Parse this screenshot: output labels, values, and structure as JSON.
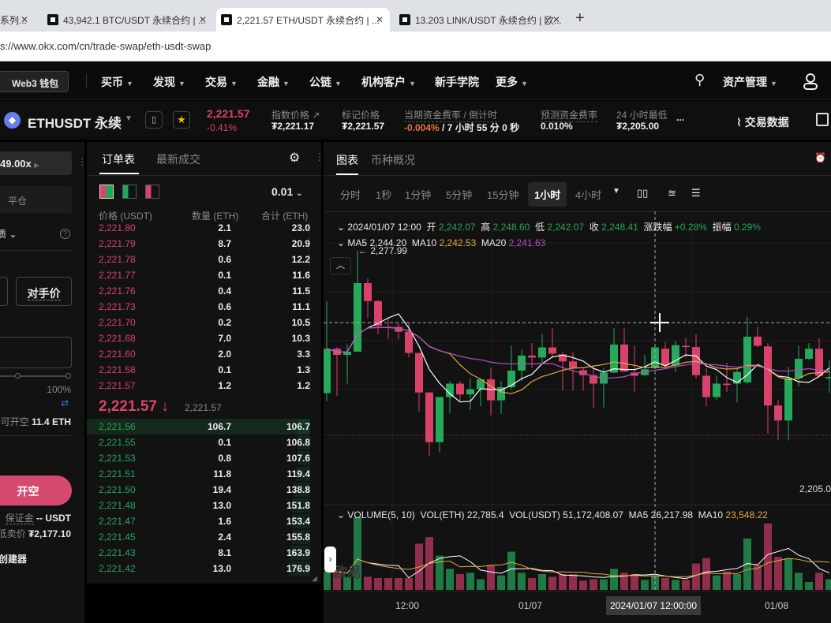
{
  "browser": {
    "tabs": [
      {
        "title": "系列..."
      },
      {
        "title": "43,942.1 BTC/USDT 永续合约 | ..."
      },
      {
        "title": "2,221.57 ETH/USDT 永续合约 | ...",
        "active": true
      },
      {
        "title": "13.203 LINK/USDT 永续合约 | 欧..."
      }
    ],
    "new_tab": "+",
    "url": "s://www.okx.com/cn/trade-swap/eth-usdt-swap"
  },
  "nav": {
    "wallet": "Web3 钱包",
    "items": [
      "买币",
      "发现",
      "交易",
      "金融",
      "公链",
      "机构客户",
      "新手学院",
      "更多"
    ],
    "assets": "资产管理"
  },
  "ticker": {
    "symbol": "ETHUSDT 永续",
    "price": "2,221.57",
    "change": "-0.41%",
    "index_label": "指数价格",
    "index_value": "₮2,221.17",
    "mark_label": "标记价格",
    "mark_value": "₮2,221.57",
    "funding_label": "当期资金费率 / 倒计时",
    "funding_rate": "-0.004%",
    "funding_countdown": " / 7 小时 55 分 0 秒",
    "pred_label": "预测资金费率",
    "pred_value": "0.010%",
    "low_label": "24 小时最低",
    "low_value": "₮2,205.00",
    "more": "...",
    "trade_data": "交易数据"
  },
  "order_form": {
    "leverage": "49.00x",
    "close_tab": "平仓",
    "mode": "质",
    "opponent_price": "对手价",
    "slider_max": "100%",
    "avail_label": "可开空",
    "avail_value": "11.4 ETH",
    "open_short": "开空",
    "margin_label": "保证金",
    "margin_value": "-- USDT",
    "min_sell_label": "低卖价",
    "min_sell_value": "₮2,177.10",
    "creator": "创建器"
  },
  "orderbook": {
    "tabs": [
      "订单表",
      "最新成交"
    ],
    "precision": "0.01",
    "headers": [
      "价格 (USDT)",
      "数量 (ETH)",
      "合计 (ETH)"
    ],
    "asks": [
      [
        "2,221.80",
        "2.1",
        "23.0"
      ],
      [
        "2,221.79",
        "8.7",
        "20.9"
      ],
      [
        "2,221.78",
        "0.6",
        "12.2"
      ],
      [
        "2,221.77",
        "0.1",
        "11.6"
      ],
      [
        "2,221.76",
        "0.4",
        "11.5"
      ],
      [
        "2,221.73",
        "0.6",
        "11.1"
      ],
      [
        "2,221.70",
        "0.2",
        "10.5"
      ],
      [
        "2,221.68",
        "7.0",
        "10.3"
      ],
      [
        "2,221.60",
        "2.0",
        "3.3"
      ],
      [
        "2,221.58",
        "0.1",
        "1.3"
      ],
      [
        "2,221.57",
        "1.2",
        "1.2"
      ]
    ],
    "last_price": "2,221.57",
    "last_arrow": "↓",
    "mark_price": "2,221.57",
    "bids": [
      [
        "2,221.56",
        "106.7",
        "106.7"
      ],
      [
        "2,221.55",
        "0.1",
        "106.8"
      ],
      [
        "2,221.53",
        "0.8",
        "107.6"
      ],
      [
        "2,221.51",
        "11.8",
        "119.4"
      ],
      [
        "2,221.50",
        "19.4",
        "138.8"
      ],
      [
        "2,221.48",
        "13.0",
        "151.8"
      ],
      [
        "2,221.47",
        "1.6",
        "153.4"
      ],
      [
        "2,221.45",
        "2.4",
        "155.8"
      ],
      [
        "2,221.43",
        "8.1",
        "163.9"
      ],
      [
        "2,221.42",
        "13.0",
        "176.9"
      ]
    ]
  },
  "chart_panel": {
    "tabs": [
      "图表",
      "币种概况"
    ],
    "timeframes": [
      "分时",
      "1秒",
      "1分钟",
      "5分钟",
      "15分钟",
      "1小时",
      "4小时"
    ],
    "active_timeframe": "1小时",
    "ohlc": {
      "date": "2024/01/07 12:00",
      "open_label": "开",
      "open": "2,242.07",
      "high_label": "高",
      "high": "2,248.60",
      "low_label": "低",
      "low": "2,242.07",
      "close_label": "收",
      "close": "2,248.41",
      "chg_label": "涨跌幅",
      "chg": "+0.28%",
      "amp_label": "振幅",
      "amp": "0.29%"
    },
    "ma": {
      "ma5_label": "MA5",
      "ma5": "2,244.20",
      "ma10_label": "MA10",
      "ma10": "2,242.53",
      "ma20_label": "MA20",
      "ma20": "2,241.63"
    },
    "high_marker": "← 2,277.99",
    "low_marker": "2,205.0",
    "volume": {
      "title": "VOLUME(5, 10)",
      "eth_label": "VOL(ETH)",
      "eth": "22,785.4",
      "usdt_label": "VOL(USDT)",
      "usdt": "51,172,408.07",
      "ma5_label": "MA5",
      "ma5": "26,217.98",
      "ma10_label": "MA10",
      "ma10": "23,548.22"
    },
    "x_labels": [
      "12:00",
      "01/07",
      "01/08"
    ],
    "crosshair_time": "2024/01/07 12:00:00",
    "watermark": "欧易"
  },
  "colors": {
    "up": "#26a95a",
    "down": "#d9436b",
    "ma5": "#ffffff",
    "ma10": "#e5a93b",
    "ma20": "#b04fc4"
  },
  "chart_data": {
    "type": "candlestick",
    "interval": "1h",
    "ohlc": [
      [
        2234.4,
        2262.6,
        2232.0,
        2248.0
      ],
      [
        2248.0,
        2248.5,
        2233.6,
        2246.1
      ],
      [
        2246.1,
        2249.3,
        2237.3,
        2247.1
      ],
      [
        2247.1,
        2277.99,
        2247.1,
        2268.1
      ],
      [
        2268.1,
        2269.5,
        2257.4,
        2262.6
      ],
      [
        2262.6,
        2263.0,
        2252.5,
        2255.0
      ],
      [
        2254.7,
        2257.4,
        2250.9,
        2254.4
      ],
      [
        2254.7,
        2255.8,
        2250.9,
        2253.2
      ],
      [
        2253.2,
        2255.8,
        2245.3,
        2246.7
      ],
      [
        2246.7,
        2246.7,
        2228.8,
        2234.6
      ],
      [
        2234.6,
        2234.6,
        2215.1,
        2219.4
      ],
      [
        2219.4,
        2233.2,
        2216.3,
        2233.2
      ],
      [
        2233.2,
        2238.1,
        2228.2,
        2237.3
      ],
      [
        2237.3,
        2238.1,
        2232.0,
        2234.0
      ],
      [
        2234.0,
        2238.9,
        2229.2,
        2235.6
      ],
      [
        2235.6,
        2238.9,
        2230.4,
        2238.6
      ],
      [
        2238.6,
        2242.1,
        2227.6,
        2232.2
      ],
      [
        2232.2,
        2238.1,
        2228.0,
        2236.2
      ],
      [
        2236.2,
        2248.9,
        2235.6,
        2241.3
      ],
      [
        2241.3,
        2247.7,
        2238.1,
        2245.9
      ],
      [
        2245.9,
        2249.7,
        2242.1,
        2245.3
      ],
      [
        2245.3,
        2252.5,
        2243.7,
        2248.4
      ],
      [
        2248.4,
        2254.2,
        2245.3,
        2246.5
      ],
      [
        2246.3,
        2246.9,
        2235.2,
        2244.1
      ],
      [
        2244.1,
        2246.9,
        2235.2,
        2242.1
      ],
      [
        2241.4,
        2242.1,
        2235.2,
        2239.9
      ],
      [
        2239.9,
        2242.1,
        2230.0,
        2237.3
      ],
      [
        2237.3,
        2242.1,
        2230.0,
        2240.7
      ],
      [
        2240.7,
        2254.2,
        2240.5,
        2249.3
      ],
      [
        2249.3,
        2254.2,
        2240.9,
        2241.0
      ],
      [
        2240.7,
        2248.9,
        2234.8,
        2239.7
      ],
      [
        2239.9,
        2246.1,
        2239.7,
        2241.7
      ],
      [
        2242.07,
        2248.6,
        2242.07,
        2248.41
      ],
      [
        2248.0,
        2250.1,
        2242.1,
        2242.9
      ],
      [
        2242.9,
        2250.5,
        2240.9,
        2249.1
      ],
      [
        2248.9,
        2251.3,
        2245.3,
        2248.5
      ],
      [
        2248.5,
        2252.5,
        2238.9,
        2239.9
      ],
      [
        2239.7,
        2242.1,
        2230.4,
        2233.2
      ],
      [
        2233.2,
        2239.7,
        2232.4,
        2237.3
      ],
      [
        2237.3,
        2243.7,
        2234.8,
        2236.9
      ],
      [
        2237.3,
        2242.1,
        2231.6,
        2240.9
      ],
      [
        2237.7,
        2257.8,
        2237.3,
        2251.7
      ],
      [
        2251.7,
        2254.6,
        2248.5,
        2248.9
      ],
      [
        2248.7,
        2249.7,
        2222.0,
        2230.6
      ],
      [
        2230.6,
        2232.4,
        2219.9,
        2226.0
      ],
      [
        2226.0,
        2242.5,
        2219.9,
        2239.0
      ],
      [
        2239.0,
        2248.9,
        2236.4,
        2244.9
      ],
      [
        2244.9,
        2249.7,
        2244.5,
        2248.0
      ],
      [
        2248.0,
        2251.3,
        2239.3,
        2239.7
      ],
      [
        2238.9,
        2244.5,
        2234.4,
        2239.3
      ]
    ],
    "volume": [
      29000,
      29000,
      20700,
      113900,
      20700,
      18600,
      18600,
      18600,
      18600,
      72500,
      82800,
      53800,
      33100,
      24800,
      26900,
      16600,
      39300,
      22800,
      60000,
      26900,
      18600,
      24800,
      20700,
      24800,
      24800,
      14500,
      16600,
      16600,
      33100,
      26900,
      24800,
      15700,
      22785.4,
      18600,
      15700,
      15700,
      41400,
      49700,
      22800,
      29000,
      24800,
      80700,
      39300,
      104300,
      51800,
      49700,
      26900,
      12400,
      26900,
      16600
    ],
    "crosshair_index": 32,
    "price_range": [
      2205,
      2278
    ],
    "liquidation_line": 2221.57,
    "crosshair_price": 2256
  }
}
